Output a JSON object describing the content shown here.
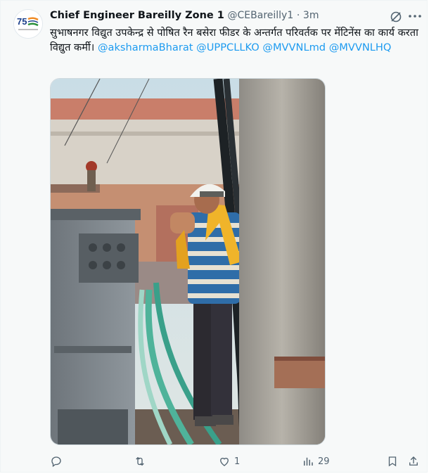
{
  "tweet": {
    "author_name": "Chief Engineer Bareilly Zone 1",
    "author_handle": "@CEBareilly1",
    "separator": "·",
    "time": "3m",
    "text_main": "सुभाषनगर विद्युत उपकेन्द्र से पोषित रैन बसेरा फीडर के अन्तर्गत परिवर्तक पर मेंटिनेंस का कार्य करता विद्युत कर्मी।",
    "mentions": [
      "@aksharmaBharat",
      "@UPPCLLKO",
      "@MVVNLmd",
      "@MVVNLHQ"
    ]
  },
  "actions": {
    "reply_count": "",
    "retweet_count": "",
    "like_count": "1",
    "views_count": "29"
  },
  "icons": {
    "avatar": "75-years-logo-icon",
    "grok": "grok-icon",
    "more": "more-icon",
    "reply": "reply-icon",
    "retweet": "retweet-icon",
    "like": "heart-icon",
    "views": "analytics-icon",
    "bookmark": "bookmark-icon",
    "share": "share-icon"
  },
  "colors": {
    "link": "#1d9bf0",
    "text": "#0f1419",
    "muted": "#536471"
  }
}
